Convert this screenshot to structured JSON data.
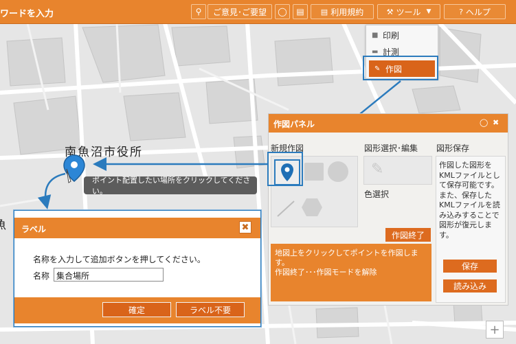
{
  "toolbar": {
    "search_placeholder": "ワードを入力",
    "feedback_label": "ご意見･ご要望",
    "terms_label": "利用規約",
    "tools_label": "ツール",
    "help_label": "ヘルプ"
  },
  "tools_menu": {
    "items": [
      {
        "label": "印刷",
        "icon": "printer-icon"
      },
      {
        "label": "計測",
        "icon": "ruler-icon"
      },
      {
        "label": "作図",
        "icon": "pencil-icon"
      }
    ]
  },
  "map": {
    "place_label": "南魚沼市役所",
    "partial_label": "魚",
    "tooltip": "ポイント配置したい場所をクリックしてください。"
  },
  "draw_panel": {
    "title": "作図パネル",
    "new_drawing_label": "新規作図",
    "select_edit_label": "図形選択･編集",
    "save_section_label": "図形保存",
    "color_label": "色選択",
    "end_button": "作図終了",
    "message_line1": "地図上をクリックしてポイントを作図します。",
    "message_line2": "作図終了･･･作図モードを解除",
    "save_description": "作図した図形をKMLファイルとして保存可能です。また、保存したKMLファイルを読み込みすることで図形が復元します。",
    "save_button": "保存",
    "load_button": "読み込み"
  },
  "label_dialog": {
    "title": "ラベル",
    "instruction": "名称を入力して追加ボタンを押してください。",
    "name_label": "名称",
    "name_value": "集合場所",
    "confirm_button": "確定",
    "no_label_button": "ラベル不要"
  },
  "colors": {
    "accent": "#e8842d",
    "accent_dark": "#d9641a",
    "annotation": "#2b7bbd",
    "pin": "#1f6fb5"
  }
}
